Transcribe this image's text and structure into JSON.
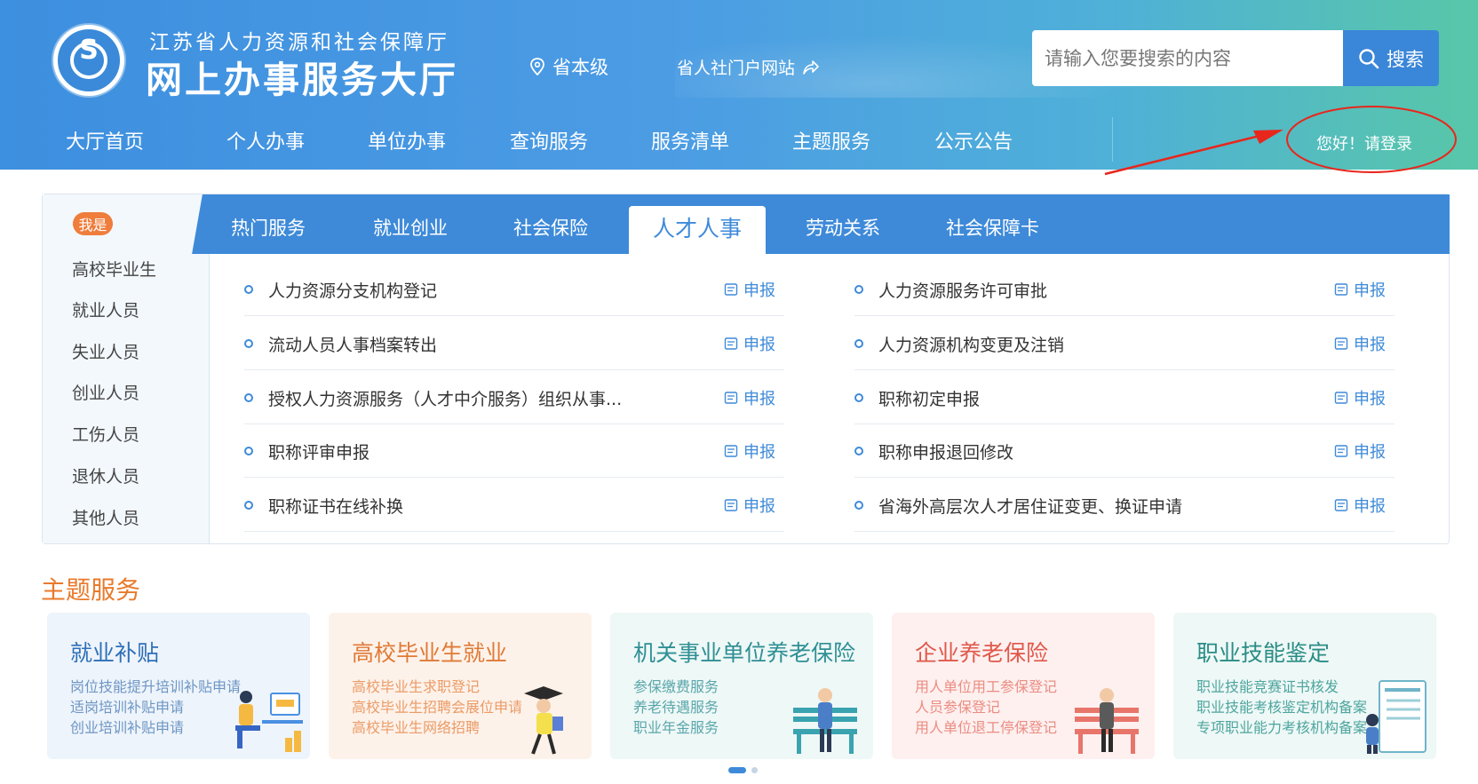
{
  "header": {
    "site_subtitle": "江苏省人力资源和社会保障厅",
    "site_title": "网上办事服务大厅",
    "region": "省本级",
    "portal_link": "省人社门户网站",
    "search_placeholder": "请输入您要搜索的内容",
    "search_button": "搜索",
    "login": "您好！请登录"
  },
  "nav": [
    "大厅首页",
    "个人办事",
    "单位办事",
    "查询服务",
    "服务清单",
    "主题服务",
    "公示公告"
  ],
  "persona": {
    "badge": "我是",
    "items": [
      "高校毕业生",
      "就业人员",
      "失业人员",
      "创业人员",
      "工伤人员",
      "退休人员",
      "其他人员"
    ]
  },
  "tabs": [
    "热门服务",
    "就业创业",
    "社会保险",
    "人才人事",
    "劳动关系",
    "社会保障卡"
  ],
  "active_tab": "人才人事",
  "apply_label": "申报",
  "services_left": [
    "人力资源分支机构登记",
    "流动人员人事档案转出",
    "授权人力资源服务（人才中介服务）组织从事...",
    "职称评审申报",
    "职称证书在线补换"
  ],
  "services_right": [
    "人力资源服务许可审批",
    "人力资源机构变更及注销",
    "职称初定申报",
    "职称申报退回修改",
    "省海外高层次人才居住证变更、换证申请"
  ],
  "theme": {
    "title": "主题服务",
    "cards": [
      {
        "title": "就业补贴",
        "lines": [
          "岗位技能提升培训补贴申请",
          "适岗培训补贴申请",
          "创业培训补贴申请"
        ],
        "bg": "#eef4fb",
        "title_color": "#2d6fb8",
        "line_color": "#6d96c4"
      },
      {
        "title": "高校毕业生就业",
        "lines": [
          "高校毕业生求职登记",
          "高校毕业生招聘会展位申请",
          "高校毕业生网络招聘"
        ],
        "bg": "#fdf2ea",
        "title_color": "#e07a36",
        "line_color": "#eb9b66"
      },
      {
        "title": "机关事业单位养老保险",
        "lines": [
          "参保缴费服务",
          "养老待遇服务",
          "职业年金服务"
        ],
        "bg": "#eef8f6",
        "title_color": "#2f8f95",
        "line_color": "#5aa6ab"
      },
      {
        "title": "企业养老保险",
        "lines": [
          "用人单位用工参保登记",
          "人员参保登记",
          "用人单位退工停保登记"
        ],
        "bg": "#fdf0ef",
        "title_color": "#e0584a",
        "line_color": "#ec8c82"
      },
      {
        "title": "职业技能鉴定",
        "lines": [
          "职业技能竞赛证书核发",
          "职业技能考核鉴定机构备案",
          "专项职业能力考核机构备案"
        ],
        "bg": "#eef8f6",
        "title_color": "#2a8c86",
        "line_color": "#4ea59f"
      }
    ]
  },
  "colors": {
    "primary": "#3e8ad9",
    "accent": "#e9792b",
    "annotation": "#e8261c"
  }
}
